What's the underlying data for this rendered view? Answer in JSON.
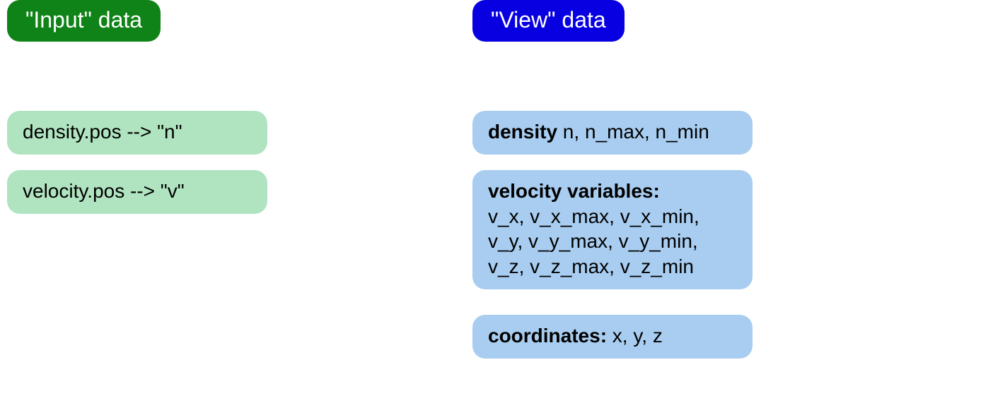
{
  "left": {
    "header": "\"Input\" data",
    "items": [
      {
        "text": "density.pos --> \"n\""
      },
      {
        "text": "velocity.pos --> \"v\""
      }
    ]
  },
  "right": {
    "header": "\"View\" data",
    "items": [
      {
        "bold": "density",
        "rest": " n, n_max, n_min"
      },
      {
        "bold": "velocity variables:",
        "rest": "\nv_x, v_x_max, v_x_min,\nv_y, v_y_max, v_y_min,\nv_z, v_z_max, v_z_min"
      },
      {
        "bold": "coordinates:",
        "rest": " x, y, z"
      }
    ]
  }
}
